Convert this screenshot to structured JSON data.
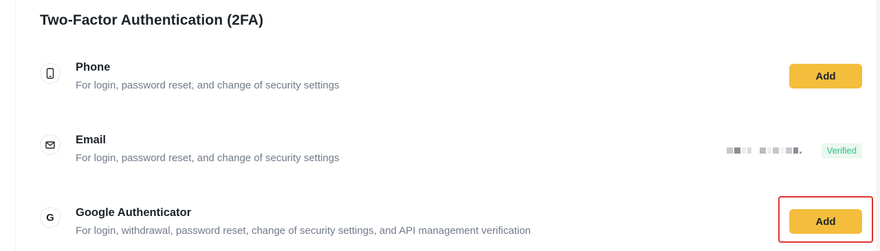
{
  "section": {
    "title": "Two-Factor Authentication (2FA)"
  },
  "methods": [
    {
      "name": "Phone",
      "icon": "phone-icon",
      "description": "For login, password reset, and change of security settings",
      "action_label": "Add"
    },
    {
      "name": "Email",
      "icon": "mail-icon",
      "description": "For login, password reset, and change of security settings",
      "masked_value": "(obscured email address)",
      "status": "Verified"
    },
    {
      "name": "Google Authenticator",
      "icon": "google-icon",
      "icon_glyph": "G",
      "description": "For login, withdrawal, password reset, change of security settings, and API management verification",
      "action_label": "Add"
    }
  ],
  "colors": {
    "accent": "#f4bd3c",
    "verified_text": "#2ebd85",
    "verified_bg": "#eaf8f0",
    "highlight": "#e0332a"
  }
}
